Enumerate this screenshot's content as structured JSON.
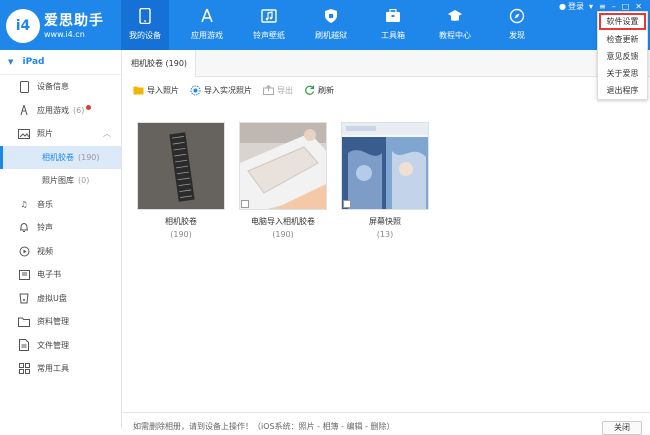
{
  "header": {
    "brand": "爱思助手",
    "url": "www.i4.cn",
    "login": "登录",
    "nav": [
      {
        "label": "我的设备",
        "icon": "phone-icon"
      },
      {
        "label": "应用游戏",
        "icon": "appstore-icon"
      },
      {
        "label": "铃声壁纸",
        "icon": "music-image-icon"
      },
      {
        "label": "刷机越狱",
        "icon": "shield-icon"
      },
      {
        "label": "工具箱",
        "icon": "toolbox-icon"
      },
      {
        "label": "教程中心",
        "icon": "graduation-cap-icon"
      },
      {
        "label": "发现",
        "icon": "compass-icon"
      }
    ],
    "accent": "#1f86ea"
  },
  "dropdown": {
    "items": [
      "软件设置",
      "检查更新",
      "意见反馈",
      "关于爱思",
      "退出程序"
    ],
    "highlight_color": "#e53935"
  },
  "sidebar": {
    "device": "iPad",
    "items": [
      {
        "label": "设备信息",
        "icon": "device-info-icon"
      },
      {
        "label": "应用游戏",
        "count": "(6)",
        "icon": "apps-icon",
        "badge": true
      },
      {
        "label": "照片",
        "icon": "photo-icon",
        "expanded": true
      },
      {
        "label": "相机胶卷",
        "count": "(190)",
        "sub": true,
        "active": true
      },
      {
        "label": "照片图库",
        "count": "(0)",
        "sub": true
      },
      {
        "label": "音乐",
        "icon": "music-note-icon"
      },
      {
        "label": "铃声",
        "icon": "bell-icon"
      },
      {
        "label": "视频",
        "icon": "video-icon"
      },
      {
        "label": "电子书",
        "icon": "book-icon"
      },
      {
        "label": "虚拟U盘",
        "icon": "usb-drive-icon"
      },
      {
        "label": "资料管理",
        "icon": "folder-icon"
      },
      {
        "label": "文件管理",
        "icon": "file-icon"
      },
      {
        "label": "常用工具",
        "icon": "grid-icon"
      }
    ]
  },
  "main": {
    "tab": "相机胶卷 (190)",
    "toolbar": {
      "import_photos": "导入照片",
      "import_live": "导入实况照片",
      "export": "导出",
      "refresh": "刷新"
    },
    "albums": [
      {
        "name": "相机胶卷",
        "count": "(190)"
      },
      {
        "name": "电脑导入相机胶卷",
        "count": "(190)"
      },
      {
        "name": "屏幕快照",
        "count": "(13)"
      }
    ],
    "status_text": "如需删除相册，请到设备上操作！（iOS系统：照片 - 相簿 - 编辑 - 删除）",
    "status_button": "关闭"
  }
}
